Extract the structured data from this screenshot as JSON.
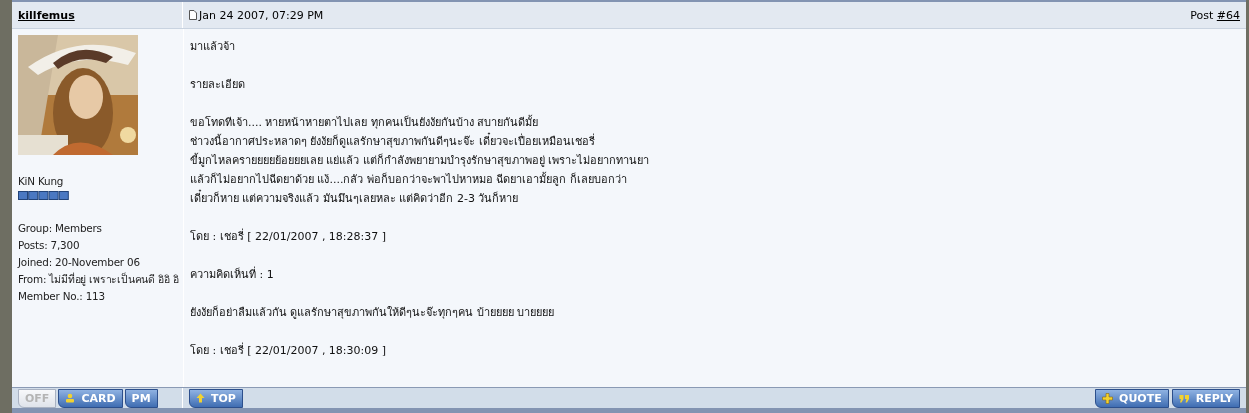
{
  "author": {
    "name": "killfemus",
    "title": "KiN Kung",
    "details": [
      "Group: Members",
      "Posts: 7,300",
      "Joined: 20-November 06",
      "From: ไม่มีที่อยู่ เพราะเป็นคนดี อิอิ อิ",
      "Member No.: 113"
    ]
  },
  "post": {
    "date": "Jan 24 2007, 07:29 PM",
    "number_label": "Post",
    "number": "#64",
    "paragraphs": [
      [
        "มาแล้วจ้า"
      ],
      [
        "รายละเอียด"
      ],
      [
        "ขอโทดทีเจ้า.... หายหน้าหายตาไปเลย ทุกคนเป็นยังงัยกันบ้าง สบายกันดีมั้ย",
        "ช่าวงนี้อากาศประหลาดๆ ยังงัยก็ดูแลรักษาสุขภาพกันดีๆนะจ๊ะ เดี๋ยวจะเปื่อยเหมือนเชอรี่",
        "ขี้มูกไหลครายยยยย้อยยยเลย แย่แล้ว แต่ก็กำลังพยายามบำรุงรักษาสุขภาพอยู่ เพราะไม่อยากทานยา",
        "แล้วก็ไม่อยากไปฉีดยาด้วย แง้....กลัว พ่อก็บอกว่าจะพาไปหาหมอ ฉีดยาเอามั้ยลูก ก็เลยบอกว่า",
        "เดี๋ยวก็หาย แต่ความจริงแล้ว มันมึนๆเลยหละ แต่คิดว่าอีก 2-3 วันก็หาย"
      ],
      [
        "โดย : เชอรี่ [ 22/01/2007 , 18:28:37 ]"
      ],
      [
        "ความคิดเห็นที่ : 1"
      ],
      [
        "ยังงัยก็อย่าลืมแล้วกัน ดูแลรักษาสุขภาพกันให้ดีๆนะจ๊ะทุกๆคน บ้ายยยย บายยยย"
      ],
      [
        "โดย : เชอรี่ [ 22/01/2007 , 18:30:09 ]"
      ]
    ]
  },
  "footer": {
    "user_buttons": [
      {
        "kind": "status",
        "label": "OFF",
        "on": false
      },
      {
        "kind": "card",
        "label": "CARD"
      },
      {
        "kind": "pm",
        "label": "PM"
      }
    ],
    "top_button": {
      "kind": "top",
      "label": "TOP"
    },
    "action_buttons": [
      {
        "kind": "quote",
        "label": "QUOTE"
      },
      {
        "kind": "reply",
        "label": "REPLY"
      }
    ]
  }
}
